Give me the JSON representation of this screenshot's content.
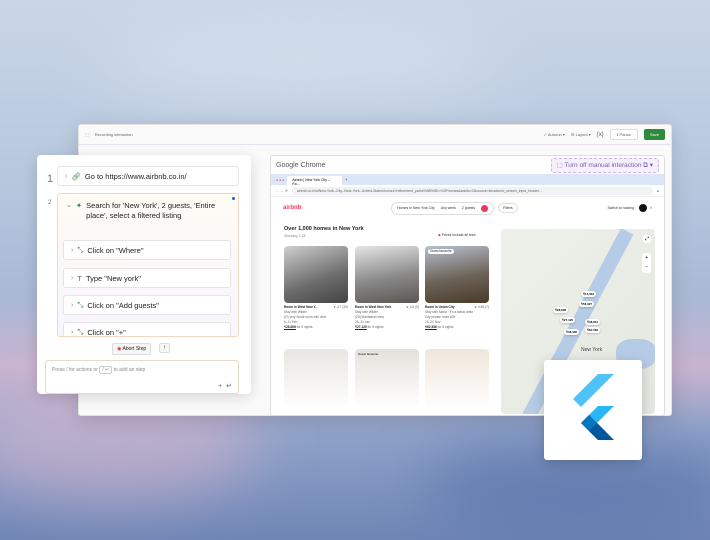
{
  "toolbar": {
    "title": "Recording interaction",
    "autorun": "Autorun",
    "layout": "Layout",
    "vars": "{x}",
    "pause": "Pause",
    "save": "Save"
  },
  "steps": [
    {
      "num": "1",
      "label": "Go to https://www.airbnb.co.in/"
    },
    {
      "num": "2",
      "label": "Search for 'New York', 2 guests, 'Entire place', select a filtered listing"
    }
  ],
  "substeps": [
    {
      "label": "Click on \"Where\""
    },
    {
      "label": "Type \"New york\""
    },
    {
      "label": "Click on \"Add guests\""
    },
    {
      "label": "Click on \"+\""
    }
  ],
  "abort": "Abort Step",
  "input": {
    "placeholder": "Press / for actions or",
    "key": "/ ↵",
    "suffix": "to add an step"
  },
  "browser": {
    "title": "Google Chrome",
    "turn_off": "Turn off manual interaction",
    "tab": "Airbnb | New York City – Ro...",
    "url": "airbnb.co.in/s/New-York--City--New-York--United-States/homes?refinement_paths%5B%5D=%2Fhomes&adults=2&source=structured_search_input_header..."
  },
  "airbnb": {
    "logo": "airbnb",
    "where": "Homes in New York City",
    "when": "Any week",
    "guests": "2 guests",
    "filters": "Filters",
    "hosting": "Switch to hosting",
    "heading": "Over 1,000 homes in New York",
    "showing": "Showing 1-18",
    "fees": "Prices include all fees",
    "listings": [
      {
        "title": "Room in West New Y...",
        "rating": "★ 4.7 (33)",
        "host": "Stay with Wilder",
        "desc": "(O) very Small room with view",
        "dates": "6–11 Feb",
        "price": "₹28,608",
        "nights": "for 5 nights"
      },
      {
        "title": "Room in West New York",
        "rating": "★ 4.6 (5)",
        "host": "Stay with Wilder",
        "desc": "(28) Manhattan view",
        "dates": "26–31 Jan",
        "price": "₹27,125",
        "nights": "for 5 nights"
      },
      {
        "title": "Room in Union City",
        "rating": "★ 4.86 (7)",
        "host": "Stay with Maria · It's a tattoo artist",
        "desc": "City private room #25",
        "dates": "15–20 Nov",
        "price": "₹62,536",
        "nights": "for 5 nights",
        "badge": "Guest favourite"
      }
    ],
    "more_badge": "Guest favourite",
    "map_pins": [
      "₹14,634",
      "₹56,327",
      "₹28,608",
      "₹27,125",
      "₹48,601",
      "₹62,536",
      "₹48,436"
    ],
    "map_label": "New York"
  }
}
